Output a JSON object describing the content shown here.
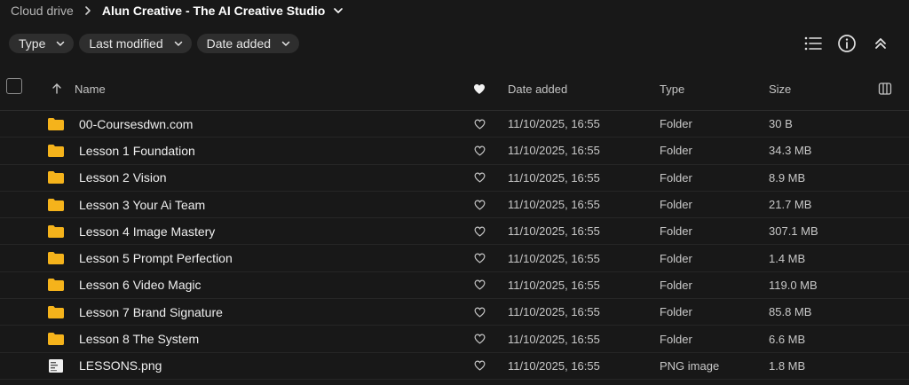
{
  "breadcrumb": {
    "root": "Cloud drive",
    "current": "Alun Creative - The AI Creative Studio"
  },
  "filters": [
    {
      "label": "Type"
    },
    {
      "label": "Last modified"
    },
    {
      "label": "Date added"
    }
  ],
  "toolbar": {
    "icons": [
      "list-view-icon",
      "info-icon",
      "collapse-up-icon"
    ]
  },
  "table": {
    "columns": {
      "name": "Name",
      "date_added": "Date added",
      "type": "Type",
      "size": "Size"
    },
    "rows": [
      {
        "name": "00-Coursesdwn.com",
        "date": "11/10/2025, 16:55",
        "type": "Folder",
        "size": "30 B",
        "icon": "folder-icon"
      },
      {
        "name": "Lesson 1 Foundation",
        "date": "11/10/2025, 16:55",
        "type": "Folder",
        "size": "34.3 MB",
        "icon": "folder-icon"
      },
      {
        "name": "Lesson 2 Vision",
        "date": "11/10/2025, 16:55",
        "type": "Folder",
        "size": "8.9 MB",
        "icon": "folder-icon"
      },
      {
        "name": "Lesson 3 Your Ai Team",
        "date": "11/10/2025, 16:55",
        "type": "Folder",
        "size": "21.7 MB",
        "icon": "folder-icon"
      },
      {
        "name": "Lesson 4 Image Mastery",
        "date": "11/10/2025, 16:55",
        "type": "Folder",
        "size": "307.1 MB",
        "icon": "folder-icon"
      },
      {
        "name": "Lesson 5 Prompt Perfection",
        "date": "11/10/2025, 16:55",
        "type": "Folder",
        "size": "1.4 MB",
        "icon": "folder-icon"
      },
      {
        "name": "Lesson 6 Video Magic",
        "date": "11/10/2025, 16:55",
        "type": "Folder",
        "size": "119.0 MB",
        "icon": "folder-icon"
      },
      {
        "name": "Lesson 7 Brand Signature",
        "date": "11/10/2025, 16:55",
        "type": "Folder",
        "size": "85.8 MB",
        "icon": "folder-icon"
      },
      {
        "name": "Lesson 8 The System",
        "date": "11/10/2025, 16:55",
        "type": "Folder",
        "size": "6.6 MB",
        "icon": "folder-icon"
      },
      {
        "name": "LESSONS.png",
        "date": "11/10/2025, 16:55",
        "type": "PNG image",
        "size": "1.8 MB",
        "icon": "image-file-icon"
      }
    ]
  },
  "colors": {
    "background": "#181818",
    "chip": "#2e2e2e",
    "folder": "#f5b31b",
    "text": "#eeeeee",
    "muted": "#c4c4c4"
  }
}
